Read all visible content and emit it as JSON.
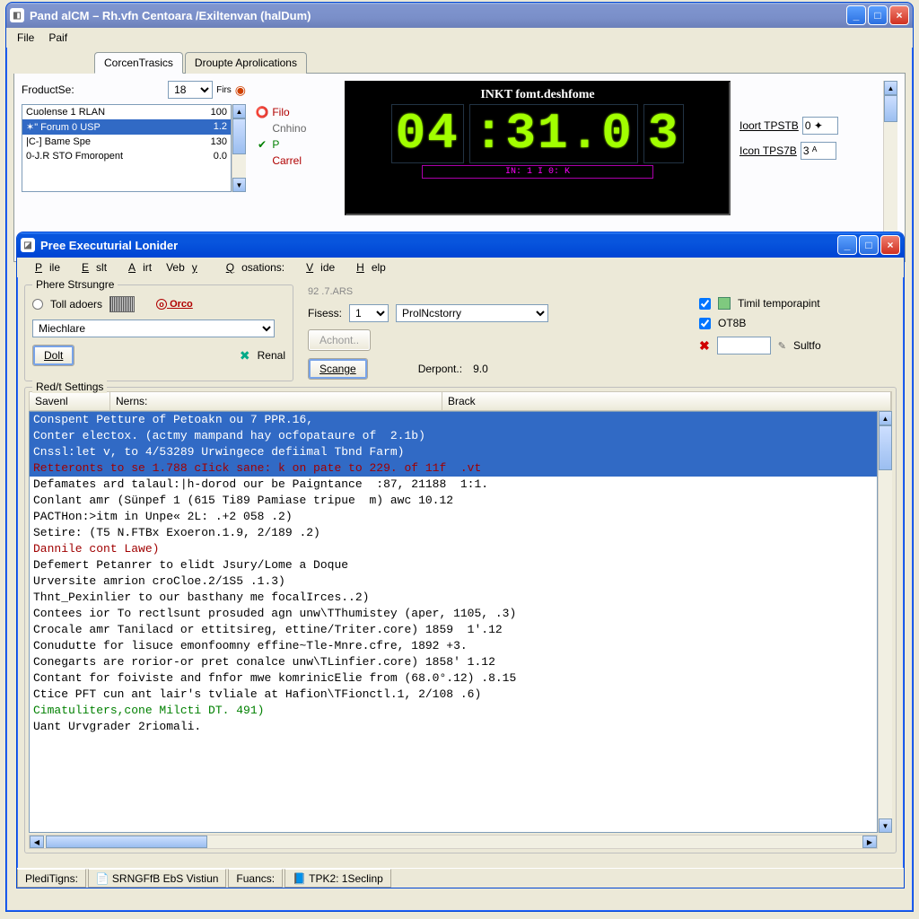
{
  "back_window": {
    "title": "Pand alCM – Rh.vfn  Centoara  /Exiltenvan  (halDum)",
    "menus": [
      "File",
      "Paif"
    ],
    "tabs": [
      "CorcenTrasics",
      "Droupte Aprolications"
    ],
    "active_tab": 0,
    "productSe_label": "FroductSe:",
    "productSe_value": "18",
    "productSe_suffix": "Firs",
    "list": [
      {
        "name": "Cuolense 1 RLAN",
        "val": "100",
        "sel": false
      },
      {
        "name": "✶\" Forum 0 USP",
        "val": "1.2",
        "sel": true
      },
      {
        "name": "|C-] Bame Spe",
        "val": "130",
        "sel": false
      },
      {
        "name": "0-J.R STO Fmoropent",
        "val": "0.0",
        "sel": false
      }
    ],
    "status_lines": [
      {
        "glyph": "⭕",
        "text": "Filo",
        "color": "#b00000"
      },
      {
        "glyph": "",
        "text": "Cnhino",
        "color": "#666"
      },
      {
        "glyph": "✔",
        "text": "P",
        "color": "#008000"
      },
      {
        "glyph": "",
        "text": "Carrel",
        "color": "#b00000"
      }
    ],
    "osc": {
      "title": "INKT fomt.deshfome",
      "digits": [
        "04",
        ":31.0",
        "3"
      ],
      "footer": "IN: 1   I 0: K"
    },
    "right_fields": [
      {
        "label": "Ioort TPSTB",
        "value": "0 ✦"
      },
      {
        "label": "Icon TPS7B",
        "value": "3  ᴬ"
      }
    ]
  },
  "front_window": {
    "title": "Pree Executurial Lonider",
    "menus": [
      "Pile",
      "Eslt",
      "Airt",
      "Veby",
      "Qosations:",
      "Vide",
      "Help"
    ],
    "group1": {
      "label": "Phere Strsungre",
      "radio_label": "Toll adoers",
      "orco_label": "Orco",
      "combo_value": "Miechlare",
      "doit_label": "Dolt",
      "renal_label": "Renal"
    },
    "group_right_label": "92 .7.ARS",
    "fisess_label": "Fisess:",
    "fisess_value": "1",
    "proln_value": "ProlNcstorry",
    "achont_label": "Achont..",
    "scange_label": "Scange",
    "derpont_label": "Derpont.:",
    "derpont_value": "9.0",
    "timil_label": "Timil temporapint",
    "otsb_label": "OT8B",
    "sultfo_label": "Sultfo",
    "settings_label": "Red/t Settings",
    "columns": [
      "Savenl",
      "Nerns:",
      "Brack"
    ],
    "log_lines": [
      {
        "t": "Conspent Petture of Petoakn ou 7 PPR.16,",
        "sel": true
      },
      {
        "t": "Conter electox. (actmy mampand hay ocfopataure of  2.1b)",
        "sel": true
      },
      {
        "t": "Cnssl:let v, to 4/53289 Urwingece defiimal Tbnd Farm)",
        "sel": true
      },
      {
        "t": "Retteronts to se 1.788 cIick sane: k on pate to 229. of 11f  .vt",
        "sel": true,
        "cls": "red"
      },
      {
        "t": "Defamates ard talaul:|h-dorod our be Paigntance  :87, 21188  1:1."
      },
      {
        "t": "Conlant amr (Sünpef 1 (615 Ti89 Pamiase tripue  m) awc 10.12"
      },
      {
        "t": "PACTHon:>itm in Unpe« 2L: .+2 058 .2)"
      },
      {
        "t": "Setire: (T5 N.FTBx Exoeron.1.9, 2/189 .2)"
      },
      {
        "t": "Dannile cont Lawe)",
        "cls": "red"
      },
      {
        "t": "Defemert Petanrer to elidt Jsury/Lome a Doque"
      },
      {
        "t": "Urversite amrion croCloe.2/1S5 .1.3)"
      },
      {
        "t": ""
      },
      {
        "t": "Thnt_Pexinlier to our basthany me focalIrces..2)"
      },
      {
        "t": "Contees ior To rectlsunt prosuded agn unw\\TThumistey (aper, 1105, .3)"
      },
      {
        "t": "Crocale amr Tanilacd or ettitsireg, ettine/Triter.core) 1859  1'.12"
      },
      {
        "t": "Conudutte for lisuce emonfoomny effine~Tle-Mnre.cfre, 1892 +3."
      },
      {
        "t": "Conegarts are rorior-or pret conalce unw\\TLinfier.core) 1858' 1.12"
      },
      {
        "t": "Contant for foiviste and fnfor mwe komrinicElie from (68.0°.12) .8.15"
      },
      {
        "t": "Ctice PFT cun ant lair's tvliale at Hafion\\TFionctl.1, 2/108 .6)"
      },
      {
        "t": "Cimatuliters,cone Milcti DT. 491)",
        "cls": "green"
      },
      {
        "t": "Uant Urvgrader 2riomali."
      }
    ],
    "status": [
      {
        "label": "PlediTigns:",
        "icon": ""
      },
      {
        "label": "SRNGFfB EbS Vistiun",
        "icon": "📄"
      },
      {
        "label": "Fuancs:",
        "icon": ""
      },
      {
        "label": "TPK2: 1Seclinp",
        "icon": "📘"
      }
    ]
  }
}
